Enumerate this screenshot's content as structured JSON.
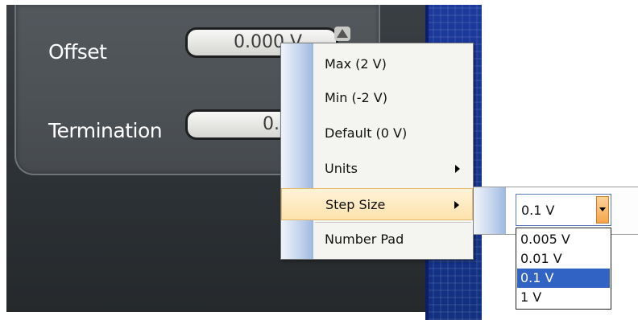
{
  "panel": {
    "offset": {
      "label": "Offset",
      "value": "0.000 V"
    },
    "termination": {
      "label": "Termination",
      "value": "0.00"
    }
  },
  "context_menu": {
    "items": [
      {
        "label": "Max  (2 V)"
      },
      {
        "label": "Min  (-2 V)"
      },
      {
        "label": "Default  (0 V)"
      },
      {
        "label": "Units"
      },
      {
        "label": "Step Size"
      },
      {
        "label": "Number Pad"
      }
    ]
  },
  "step_size": {
    "selected": "0.1 V",
    "options": [
      "0.005 V",
      "0.01 V",
      "0.1 V",
      "1 V"
    ]
  },
  "colors": {
    "highlight": "#fde2ac",
    "selection": "#3163c5",
    "panel": "#4c5155",
    "blue_bg": "#163391"
  }
}
